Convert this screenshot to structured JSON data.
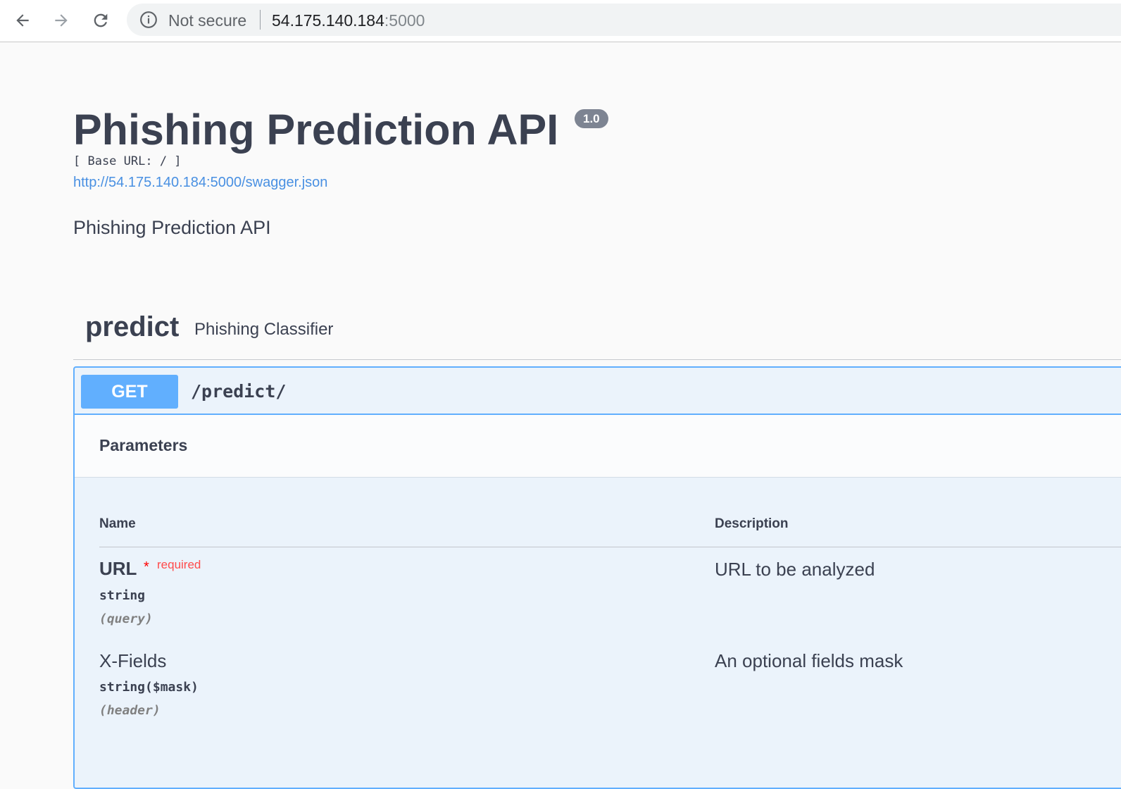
{
  "browser": {
    "back_icon": "arrow-left-icon",
    "forward_icon": "arrow-right-icon",
    "reload_icon": "reload-icon",
    "security_icon": "info-icon",
    "security_label": "Not secure",
    "url_host": "54.175.140.184",
    "url_port": ":5000"
  },
  "info": {
    "title": "Phishing Prediction API",
    "version": "1.0",
    "base_url": "[ Base URL: / ]",
    "spec_link": "http://54.175.140.184:5000/swagger.json",
    "description": "Phishing Prediction API"
  },
  "tag": {
    "name": "predict",
    "description": "Phishing Classifier"
  },
  "operation": {
    "method": "GET",
    "path": "/predict/",
    "parameters_title": "Parameters",
    "columns": [
      "Name",
      "Description"
    ],
    "params": [
      {
        "name": "URL",
        "required_star": "*",
        "required_label": "required",
        "type": "string",
        "in": "(query)",
        "description": "URL to be analyzed"
      },
      {
        "name": "X-Fields",
        "type": "string($mask)",
        "in": "(header)",
        "description": "An optional fields mask"
      }
    ]
  },
  "colors": {
    "get_accent": "#61affe",
    "get_background": "#ebf3fb",
    "text": "#3b4151",
    "link": "#4990e2",
    "required": "#ff4b4b"
  }
}
